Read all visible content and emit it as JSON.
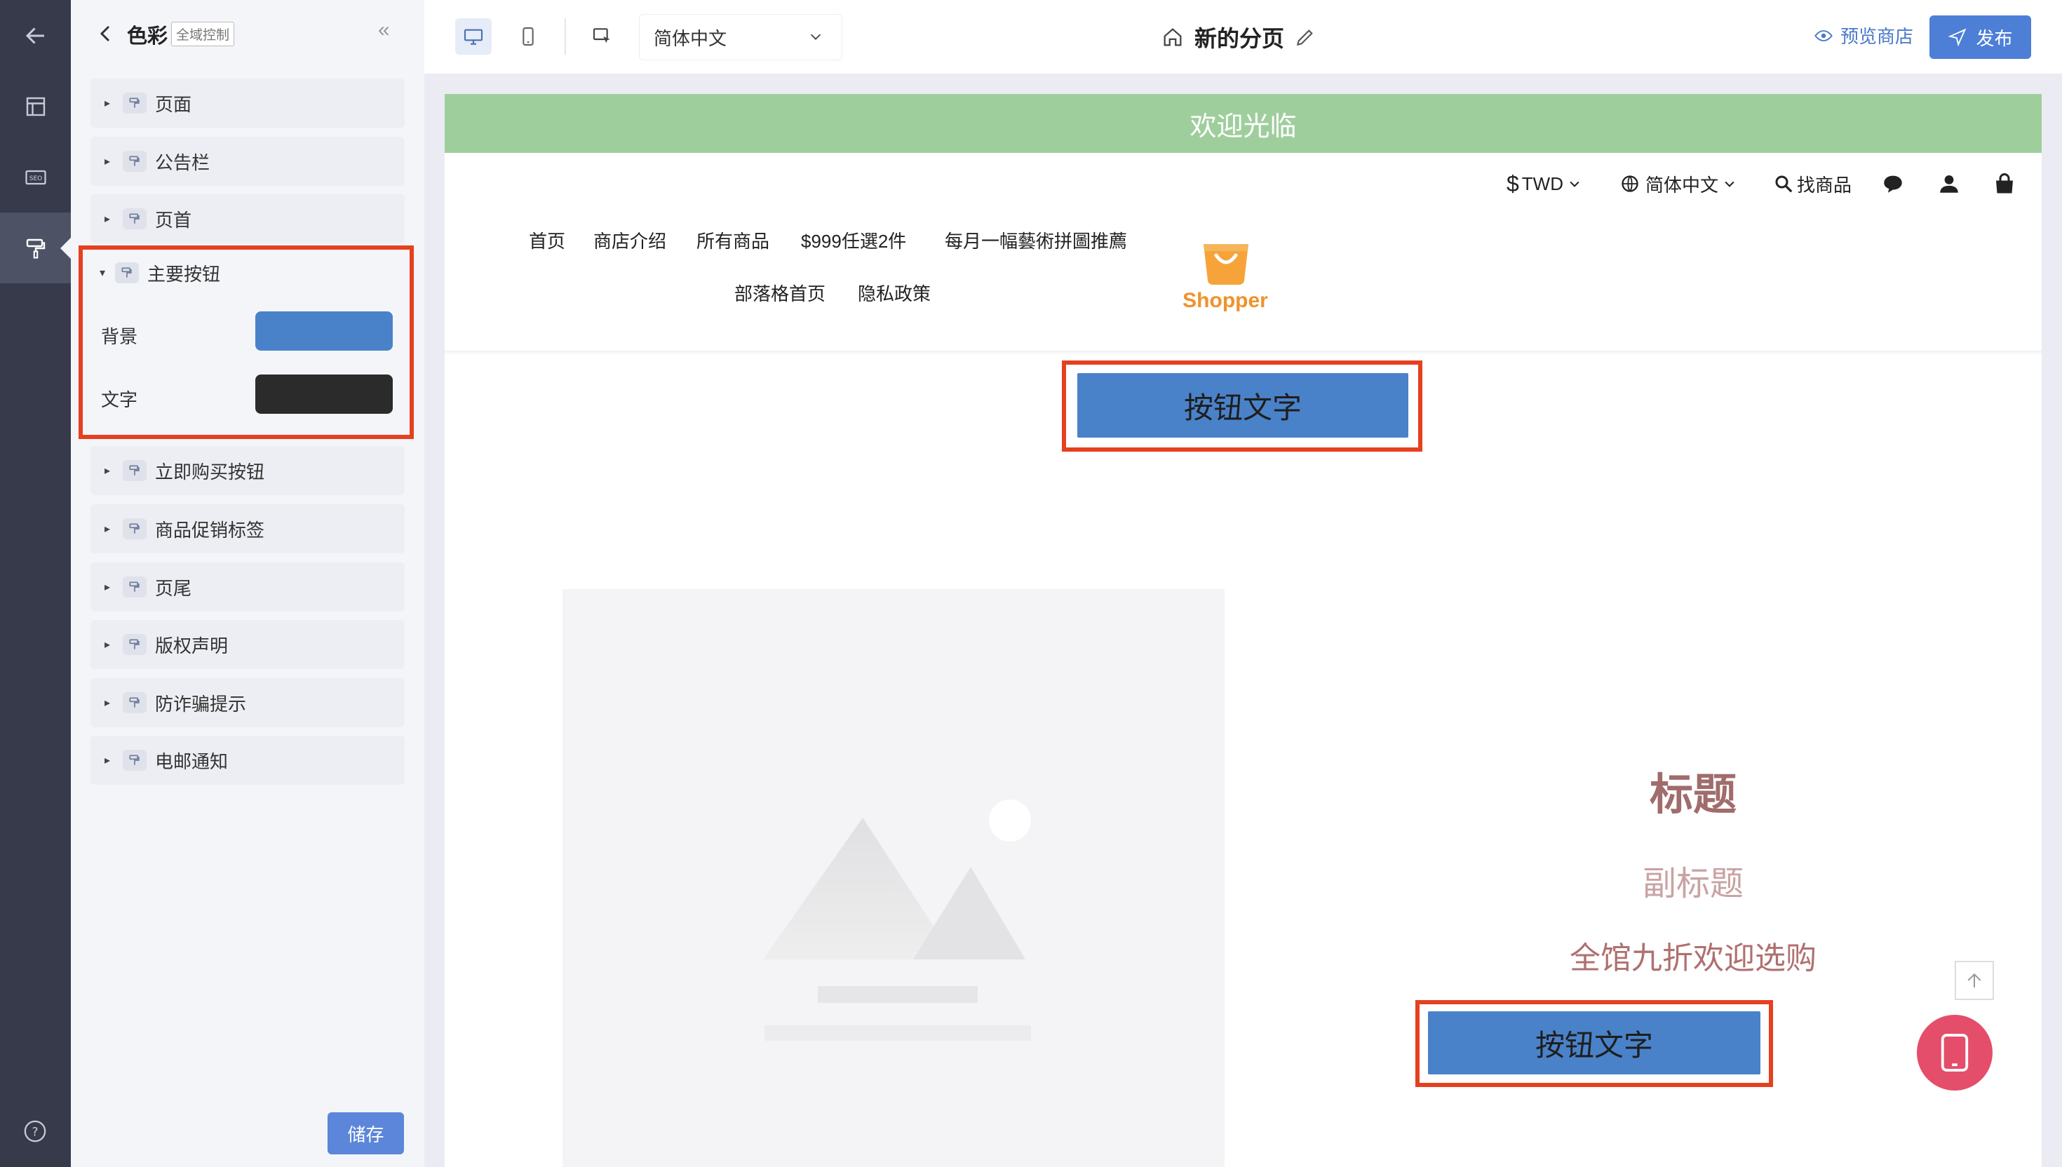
{
  "panel": {
    "title": "色彩",
    "tag": "全域控制",
    "collapse_glyph": "«",
    "items": [
      {
        "label": "页面"
      },
      {
        "label": "公告栏"
      },
      {
        "label": "页首"
      },
      {
        "label": "立即购买按钮"
      },
      {
        "label": "商品促销标签"
      },
      {
        "label": "页尾"
      },
      {
        "label": "版权声明"
      },
      {
        "label": "防诈骗提示"
      },
      {
        "label": "电邮通知"
      }
    ],
    "open_section": {
      "label": "主要按钮",
      "fields": [
        {
          "label": "背景",
          "color": "#4a82c9"
        },
        {
          "label": "文字",
          "color": "#2b2b2b"
        }
      ]
    },
    "save_label": "储存"
  },
  "toolbar": {
    "language": "简体中文",
    "page_title": "新的分页",
    "preview_label": "预览商店",
    "publish_label": "发布"
  },
  "site": {
    "announcement": "欢迎光临",
    "currency": "TWD",
    "currency_symbol": "$",
    "language": "简体中文",
    "search_label": "找商品",
    "nav_row1": [
      "首页",
      "商店介绍",
      "所有商品",
      "$999任選2件",
      "每月一幅藝術拼圖推薦"
    ],
    "nav_row2": [
      "部落格首页",
      "隐私政策"
    ],
    "logo_text": "Shopper",
    "button_text_top": "按钮文字",
    "hero": {
      "title": "标题",
      "subtitle": "副标题",
      "description": "全馆九折欢迎选购",
      "button_text": "按钮文字"
    }
  },
  "colors": {
    "accent": "#4a82c9",
    "highlight_border": "#e5401f",
    "announcement_bg": "#9fce9d",
    "logo_orange": "#f0922c",
    "fab_pink": "#e44e6a"
  }
}
